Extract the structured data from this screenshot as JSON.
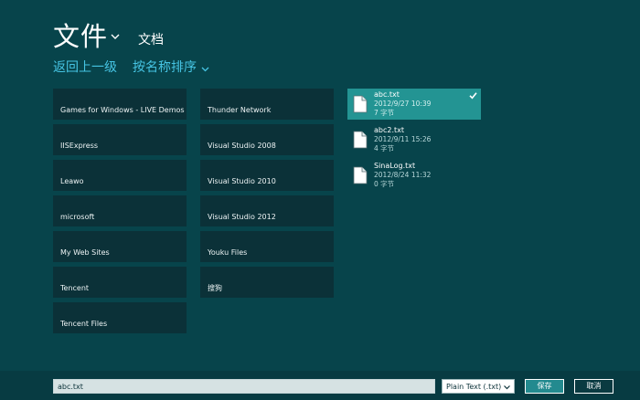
{
  "header": {
    "title": "文件",
    "location": "文档",
    "back_link": "返回上一级",
    "sort_link": "按名称排序"
  },
  "folders": [
    "Games for Windows - LIVE Demos",
    "IISExpress",
    "Leawo",
    "microsoft",
    "My Web Sites",
    "Tencent",
    "Tencent Files",
    "Thunder Network",
    "Visual Studio 2008",
    "Visual Studio 2010",
    "Visual Studio 2012",
    "Youku Files",
    "搜狗"
  ],
  "files": [
    {
      "name": "abc.txt",
      "date": "2012/9/27 10:39",
      "size": "7 字节",
      "selected": true
    },
    {
      "name": "abc2.txt",
      "date": "2012/9/11 15:26",
      "size": "4 字节",
      "selected": false
    },
    {
      "name": "SinaLog.txt",
      "date": "2012/8/24 11:32",
      "size": "0 字节",
      "selected": false
    }
  ],
  "footer": {
    "filename_value": "abc.txt",
    "filetype_selected": "Plain Text (.txt)",
    "save_label": "保存",
    "cancel_label": "取消"
  },
  "icons": {
    "title_chevron": "chevron-down-icon",
    "sort_chevron": "chevron-down-icon",
    "file": "document-icon",
    "selected_check": "check-icon",
    "select_arrow": "chevron-down-icon"
  },
  "colors": {
    "background": "#07444b",
    "tile": "#0b3138",
    "selected": "#239493",
    "link": "#46c4e3"
  }
}
